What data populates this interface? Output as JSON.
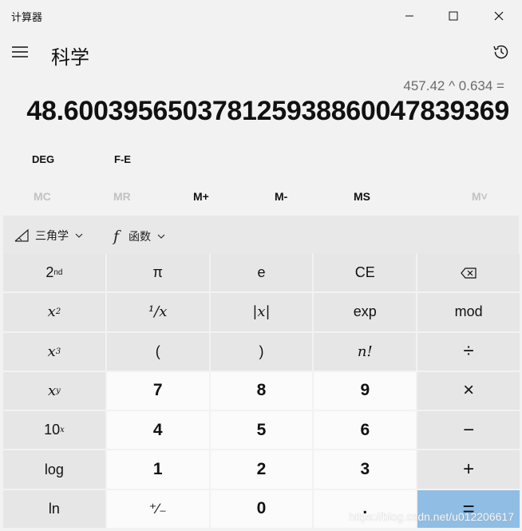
{
  "window": {
    "title": "计算器"
  },
  "header": {
    "mode_title": "科学"
  },
  "display": {
    "expression": "457.42 ^ 0.634 =",
    "result": "48.600395650378125938860047839369"
  },
  "angle": {
    "deg": "DEG",
    "fe": "F-E"
  },
  "memory": {
    "mc": "MC",
    "mr": "MR",
    "mplus": "M+",
    "mminus": "M-",
    "ms": "MS",
    "mlist": "M˅"
  },
  "funcbar": {
    "trig": "三角学",
    "func": "函数",
    "f_glyph": "f"
  },
  "keys": {
    "second": "2",
    "second_sup": "nd",
    "pi": "π",
    "e": "e",
    "ce": "CE",
    "x2_base": "x",
    "x2_sup": "2",
    "reciprocal": "¹∕x",
    "abs": "|x|",
    "exp": "exp",
    "mod": "mod",
    "x3_base": "x",
    "x3_sup": "3",
    "lparen": "(",
    "rparen": ")",
    "factorial": "n!",
    "divide": "÷",
    "xy_base": "x",
    "xy_sup": "y",
    "seven": "7",
    "eight": "8",
    "nine": "9",
    "multiply": "×",
    "ten_base": "10",
    "ten_sup": "x",
    "four": "4",
    "five": "5",
    "six": "6",
    "minus": "−",
    "log": "log",
    "one": "1",
    "two": "2",
    "three": "3",
    "plus": "+",
    "ln": "ln",
    "negate": "⁺∕₋",
    "zero": "0",
    "decimal": ".",
    "equals": "="
  },
  "watermark": "https://blog.csdn.net/u012206617"
}
